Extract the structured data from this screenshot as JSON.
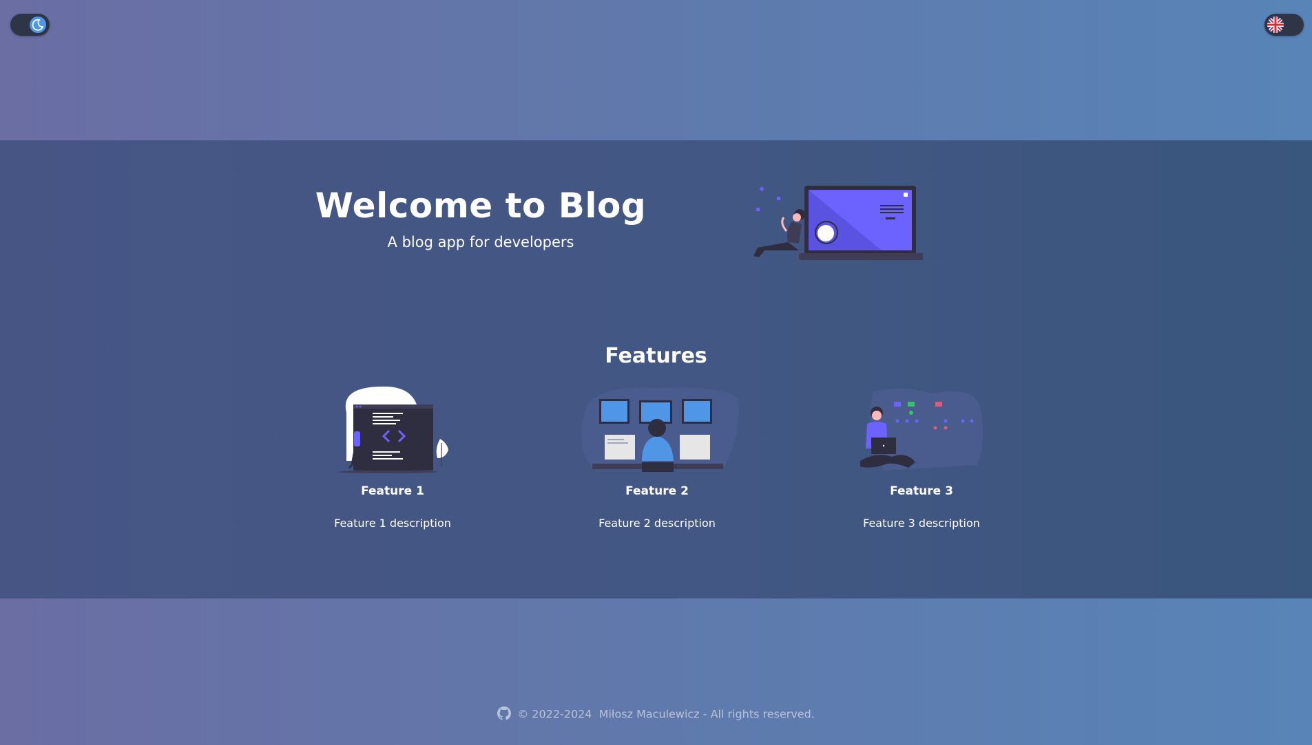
{
  "controls": {
    "theme_toggle_icon": "moon-icon",
    "language_toggle_icon": "uk-flag-icon"
  },
  "hero": {
    "title": "Welcome to Blog",
    "subtitle": "A blog app for developers",
    "illustration": "person-with-laptop-illustration"
  },
  "features": {
    "heading": "Features",
    "items": [
      {
        "title": "Feature 1",
        "description": "Feature 1 description",
        "illustration": "code-screen-illustration"
      },
      {
        "title": "Feature 2",
        "description": "Feature 2 description",
        "illustration": "developer-monitors-illustration"
      },
      {
        "title": "Feature 3",
        "description": "Feature 3 description",
        "illustration": "person-laptop-dots-illustration"
      }
    ]
  },
  "footer": {
    "text": "© 2022-2024  Miłosz Maculewicz - All rights reserved.",
    "icon": "github-icon"
  },
  "colors": {
    "accent": "#6c63ff",
    "page_background": "#6377aa",
    "section_background": "#435784",
    "toggle_background": "#2e3546"
  }
}
